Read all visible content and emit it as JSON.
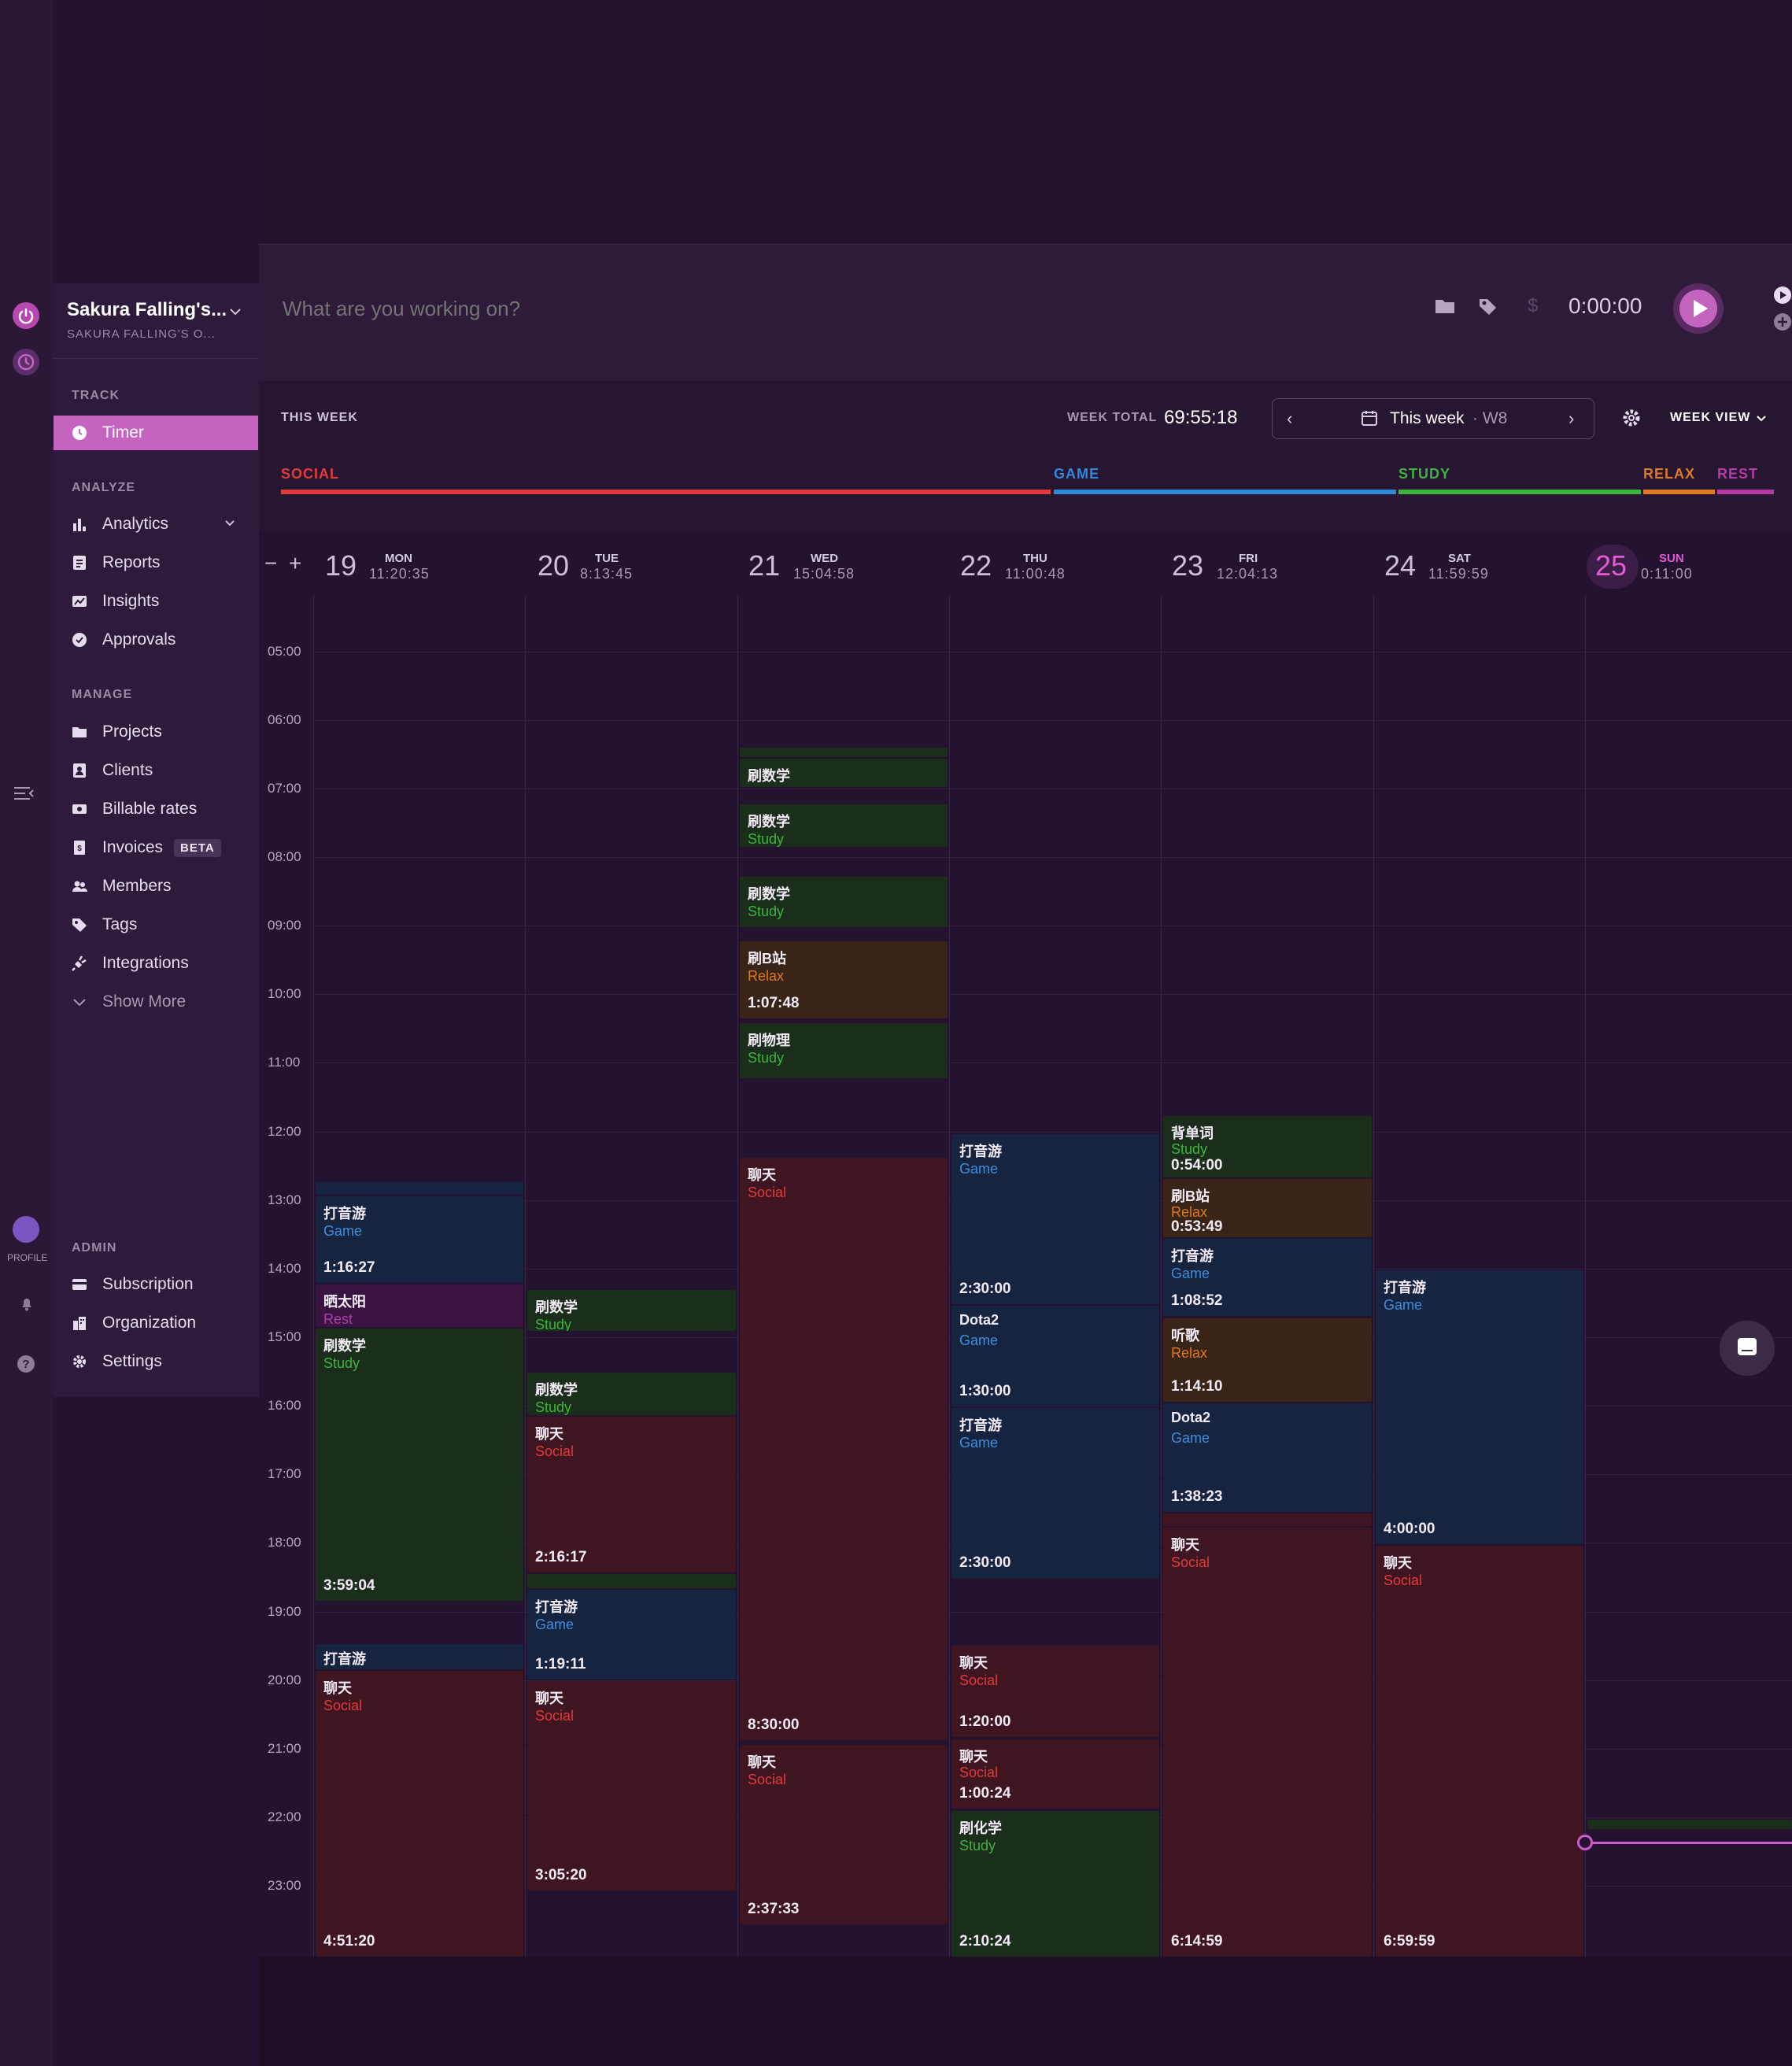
{
  "workspace": {
    "name": "Sakura Falling's...",
    "subtitle": "SAKURA FALLING'S O..."
  },
  "rail": {
    "profile_label": "PROFILE"
  },
  "sidebar": {
    "track_header": "TRACK",
    "analyze_header": "ANALYZE",
    "manage_header": "MANAGE",
    "admin_header": "ADMIN",
    "items": {
      "timer": "Timer",
      "analytics": "Analytics",
      "reports": "Reports",
      "insights": "Insights",
      "approvals": "Approvals",
      "projects": "Projects",
      "clients": "Clients",
      "billable_rates": "Billable rates",
      "invoices": "Invoices",
      "invoices_badge": "BETA",
      "members": "Members",
      "tags": "Tags",
      "integrations": "Integrations",
      "show_more": "Show More",
      "subscription": "Subscription",
      "organization": "Organization",
      "settings": "Settings"
    }
  },
  "timer": {
    "placeholder": "What are you working on?",
    "elapsed": "0:00:00",
    "currency_icon": "$"
  },
  "week": {
    "this_week_label": "THIS WEEK",
    "total_label": "WEEK TOTAL",
    "total_value": "69:55:18",
    "picker_label": "This week",
    "picker_week": "· W8",
    "view_label": "WEEK VIEW"
  },
  "legend": [
    {
      "name": "SOCIAL",
      "color": "#e23b3b"
    },
    {
      "name": "GAME",
      "color": "#2f88d8"
    },
    {
      "name": "STUDY",
      "color": "#3db43d"
    },
    {
      "name": "RELAX",
      "color": "#dd7a22"
    },
    {
      "name": "REST",
      "color": "#b43aa8"
    }
  ],
  "zoom": {
    "minus": "−",
    "plus": "+"
  },
  "days": [
    {
      "num": "19",
      "name": "MON",
      "total": "11:20:35"
    },
    {
      "num": "20",
      "name": "TUE",
      "total": "8:13:45"
    },
    {
      "num": "21",
      "name": "WED",
      "total": "15:04:58"
    },
    {
      "num": "22",
      "name": "THU",
      "total": "11:00:48"
    },
    {
      "num": "23",
      "name": "FRI",
      "total": "12:04:13"
    },
    {
      "num": "24",
      "name": "SAT",
      "total": "11:59:59"
    },
    {
      "num": "25",
      "name": "SUN",
      "total": "0:11:00"
    }
  ],
  "hours": [
    "05:00",
    "06:00",
    "07:00",
    "08:00",
    "09:00",
    "10:00",
    "11:00",
    "12:00",
    "13:00",
    "14:00",
    "15:00",
    "16:00",
    "17:00",
    "18:00",
    "19:00",
    "20:00",
    "21:00",
    "22:00",
    "23:00"
  ],
  "events": {
    "mon": [
      {
        "title": "打音游",
        "project": "Game",
        "duration": "1:16:27"
      },
      {
        "title": "晒太阳",
        "project": "Rest",
        "duration": ""
      },
      {
        "title": "刷数学",
        "project": "Study",
        "duration": "3:59:04"
      },
      {
        "title": "打音游",
        "project": "",
        "duration": ""
      },
      {
        "title": "聊天",
        "project": "Social",
        "duration": "4:51:20"
      }
    ],
    "tue": [
      {
        "title": "刷数学",
        "project": "Study",
        "duration": ""
      },
      {
        "title": "刷数学",
        "project": "Study",
        "duration": ""
      },
      {
        "title": "聊天",
        "project": "Social",
        "duration": "2:16:17"
      },
      {
        "title": "打音游",
        "project": "Game",
        "duration": "1:19:11"
      },
      {
        "title": "聊天",
        "project": "Social",
        "duration": "3:05:20"
      }
    ],
    "wed": [
      {
        "title": "刷数学",
        "project": "",
        "duration": ""
      },
      {
        "title": "刷数学",
        "project": "Study",
        "duration": ""
      },
      {
        "title": "刷数学",
        "project": "Study",
        "duration": ""
      },
      {
        "title": "刷B站",
        "project": "Relax",
        "duration": "1:07:48"
      },
      {
        "title": "刷物理",
        "project": "Study",
        "duration": ""
      },
      {
        "title": "聊天",
        "project": "Social",
        "duration": "8:30:00"
      },
      {
        "title": "聊天",
        "project": "Social",
        "duration": "2:37:33"
      }
    ],
    "thu": [
      {
        "title": "打音游",
        "project": "Game",
        "duration": "2:30:00"
      },
      {
        "title": "Dota2",
        "project": "Game",
        "duration": "1:30:00"
      },
      {
        "title": "打音游",
        "project": "Game",
        "duration": "2:30:00"
      },
      {
        "title": "聊天",
        "project": "Social",
        "duration": "1:20:00"
      },
      {
        "title": "聊天",
        "project": "Social",
        "duration": "1:00:24"
      },
      {
        "title": "刷化学",
        "project": "Study",
        "duration": "2:10:24"
      }
    ],
    "fri": [
      {
        "title": "背单词",
        "project": "Study",
        "duration": "0:54:00"
      },
      {
        "title": "刷B站",
        "project": "Relax",
        "duration": "0:53:49"
      },
      {
        "title": "打音游",
        "project": "Game",
        "duration": "1:08:52"
      },
      {
        "title": "听歌",
        "project": "Relax",
        "duration": "1:14:10"
      },
      {
        "title": "Dota2",
        "project": "Game",
        "duration": "1:38:23"
      },
      {
        "title": "聊天",
        "project": "Social",
        "duration": "6:14:59"
      }
    ],
    "sat": [
      {
        "title": "打音游",
        "project": "Game",
        "duration": "4:00:00"
      },
      {
        "title": "聊天",
        "project": "Social",
        "duration": "6:59:59"
      }
    ]
  }
}
